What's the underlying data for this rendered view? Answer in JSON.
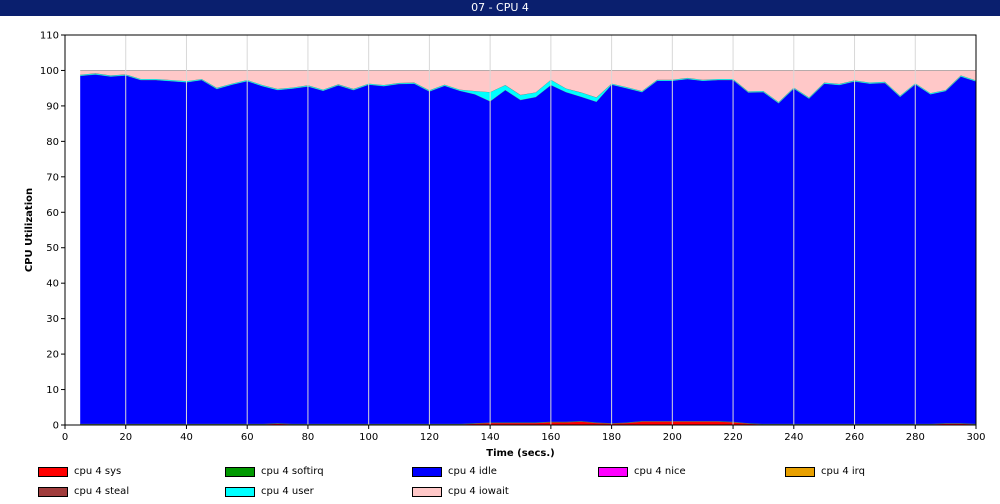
{
  "window": {
    "title": "07 - CPU 4"
  },
  "chart_data": {
    "type": "area",
    "stacked": true,
    "xlabel": "Time (secs.)",
    "ylabel": "CPU Utilization",
    "xlim": [
      0,
      300
    ],
    "ylim": [
      0,
      110
    ],
    "xticks": [
      0,
      20,
      40,
      60,
      80,
      100,
      120,
      140,
      160,
      180,
      200,
      220,
      240,
      260,
      280,
      300
    ],
    "yticks": [
      0,
      10,
      20,
      30,
      40,
      50,
      60,
      70,
      80,
      90,
      100,
      110
    ],
    "grid": true,
    "legend_placement": "bottom",
    "x": [
      5,
      10,
      15,
      20,
      25,
      30,
      35,
      40,
      45,
      50,
      55,
      60,
      65,
      70,
      75,
      80,
      85,
      90,
      95,
      100,
      105,
      110,
      115,
      120,
      125,
      130,
      135,
      140,
      145,
      150,
      155,
      160,
      165,
      170,
      175,
      180,
      185,
      190,
      195,
      200,
      205,
      210,
      215,
      220,
      225,
      230,
      235,
      240,
      245,
      250,
      255,
      260,
      265,
      270,
      275,
      280,
      285,
      290,
      295,
      300
    ],
    "series": [
      {
        "name": "cpu 4 sys",
        "color": "#ff0000",
        "values": [
          0.2,
          0.2,
          0.2,
          0.2,
          0.2,
          0.2,
          0.2,
          0.2,
          0.2,
          0.2,
          0.2,
          0.2,
          0.2,
          0.4,
          0.2,
          0.2,
          0.2,
          0.2,
          0.2,
          0.2,
          0.2,
          0.2,
          0.2,
          0.2,
          0.2,
          0.2,
          0.4,
          0.6,
          0.6,
          0.6,
          0.6,
          0.8,
          0.8,
          1.0,
          0.6,
          0.4,
          0.6,
          1.0,
          1.0,
          1.0,
          1.0,
          1.0,
          1.0,
          0.8,
          0.4,
          0.2,
          0.2,
          0.2,
          0.2,
          0.2,
          0.2,
          0.2,
          0.2,
          0.2,
          0.2,
          0.2,
          0.2,
          0.4,
          0.4,
          0.2
        ]
      },
      {
        "name": "cpu 4 softirq",
        "color": "#009900",
        "values": [
          0.1,
          0.1,
          0.1,
          0.1,
          0.1,
          0.1,
          0.1,
          0.1,
          0.1,
          0.1,
          0.1,
          0.1,
          0.1,
          0.1,
          0.1,
          0.1,
          0.1,
          0.1,
          0.1,
          0.1,
          0.1,
          0.1,
          0.1,
          0.1,
          0.1,
          0.1,
          0.1,
          0.1,
          0.1,
          0.1,
          0.1,
          0.1,
          0.1,
          0.1,
          0.1,
          0.1,
          0.1,
          0.1,
          0.1,
          0.1,
          0.1,
          0.1,
          0.1,
          0.1,
          0.1,
          0.1,
          0.1,
          0.1,
          0.1,
          0.1,
          0.1,
          0.1,
          0.1,
          0.1,
          0.1,
          0.1,
          0.1,
          0.1,
          0.1,
          0.1
        ]
      },
      {
        "name": "cpu 4 idle",
        "color": "#0000ff",
        "values": [
          98.2,
          98.6,
          98.0,
          98.3,
          97.0,
          97.0,
          96.7,
          96.4,
          97.0,
          94.5,
          95.7,
          96.7,
          95.3,
          94.0,
          94.6,
          95.2,
          94.0,
          95.5,
          94.2,
          95.7,
          95.3,
          95.9,
          96.0,
          93.8,
          95.4,
          94.0,
          92.8,
          90.6,
          93.8,
          91.0,
          91.8,
          95.0,
          93.0,
          91.5,
          90.5,
          95.5,
          94.3,
          92.8,
          96.0,
          96.0,
          96.5,
          96.0,
          96.2,
          96.4,
          93.3,
          93.6,
          90.5,
          94.6,
          91.8,
          96.0,
          95.6,
          96.6,
          96.0,
          96.2,
          92.3,
          95.8,
          93.0,
          93.7,
          97.8,
          96.6
        ]
      },
      {
        "name": "cpu 4 nice",
        "color": "#ff00ff",
        "values": [
          0,
          0,
          0,
          0,
          0,
          0,
          0,
          0,
          0,
          0,
          0,
          0,
          0,
          0,
          0,
          0,
          0,
          0,
          0,
          0,
          0,
          0,
          0,
          0,
          0,
          0,
          0,
          0,
          0,
          0,
          0,
          0,
          0,
          0,
          0,
          0,
          0,
          0,
          0,
          0,
          0,
          0,
          0,
          0,
          0,
          0,
          0,
          0,
          0,
          0,
          0,
          0,
          0,
          0,
          0,
          0,
          0,
          0,
          0,
          0
        ]
      },
      {
        "name": "cpu 4 irq",
        "color": "#e8a000",
        "values": [
          0,
          0,
          0,
          0,
          0,
          0,
          0,
          0,
          0,
          0,
          0,
          0,
          0,
          0,
          0,
          0,
          0,
          0,
          0,
          0,
          0,
          0,
          0,
          0,
          0,
          0,
          0,
          0,
          0,
          0,
          0,
          0,
          0,
          0,
          0,
          0,
          0,
          0,
          0,
          0,
          0,
          0,
          0,
          0,
          0,
          0,
          0,
          0,
          0,
          0,
          0,
          0,
          0,
          0,
          0,
          0,
          0,
          0,
          0,
          0
        ]
      },
      {
        "name": "cpu 4 steal",
        "color": "#a03c3c",
        "values": [
          0,
          0,
          0,
          0,
          0,
          0,
          0,
          0,
          0,
          0,
          0,
          0,
          0,
          0,
          0,
          0,
          0,
          0,
          0,
          0,
          0,
          0,
          0,
          0,
          0,
          0,
          0,
          0,
          0,
          0,
          0,
          0,
          0,
          0,
          0,
          0,
          0,
          0,
          0,
          0,
          0,
          0,
          0,
          0,
          0,
          0,
          0,
          0,
          0,
          0,
          0,
          0,
          0,
          0,
          0,
          0,
          0,
          0,
          0,
          0
        ]
      },
      {
        "name": "cpu 4 user",
        "color": "#00ffff",
        "values": [
          0.3,
          0.3,
          0.3,
          0.3,
          0.3,
          0.3,
          0.3,
          0.3,
          0.3,
          0.3,
          0.3,
          0.3,
          0.3,
          0.3,
          0.3,
          0.3,
          0.3,
          0.3,
          0.3,
          0.3,
          0.3,
          0.3,
          0.3,
          0.3,
          0.3,
          0.3,
          0.9,
          2.6,
          1.4,
          1.4,
          1.3,
          1.5,
          1.0,
          1.2,
          1.2,
          0.3,
          0.3,
          0.3,
          0.3,
          0.3,
          0.3,
          0.3,
          0.3,
          0.3,
          0.3,
          0.3,
          0.3,
          0.3,
          0.3,
          0.3,
          0.3,
          0.3,
          0.3,
          0.3,
          0.3,
          0.3,
          0.3,
          0.3,
          0.3,
          0.3
        ]
      },
      {
        "name": "cpu 4 iowait",
        "color": "#ffc8c8",
        "values": [
          1.2,
          0.8,
          1.4,
          1.1,
          2.4,
          2.4,
          2.7,
          3.0,
          2.4,
          4.9,
          3.7,
          2.7,
          4.1,
          5.2,
          4.8,
          4.2,
          5.4,
          3.9,
          5.2,
          3.7,
          4.1,
          3.5,
          3.4,
          5.6,
          4.0,
          5.4,
          5.8,
          6.1,
          4.1,
          6.9,
          6.2,
          2.6,
          5.1,
          6.2,
          7.6,
          3.7,
          4.7,
          5.8,
          2.6,
          2.6,
          2.1,
          2.6,
          2.4,
          2.4,
          5.9,
          5.8,
          8.9,
          4.8,
          7.6,
          3.4,
          3.8,
          2.8,
          3.4,
          3.2,
          7.1,
          3.6,
          6.4,
          5.5,
          1.4,
          2.8
        ]
      }
    ]
  }
}
